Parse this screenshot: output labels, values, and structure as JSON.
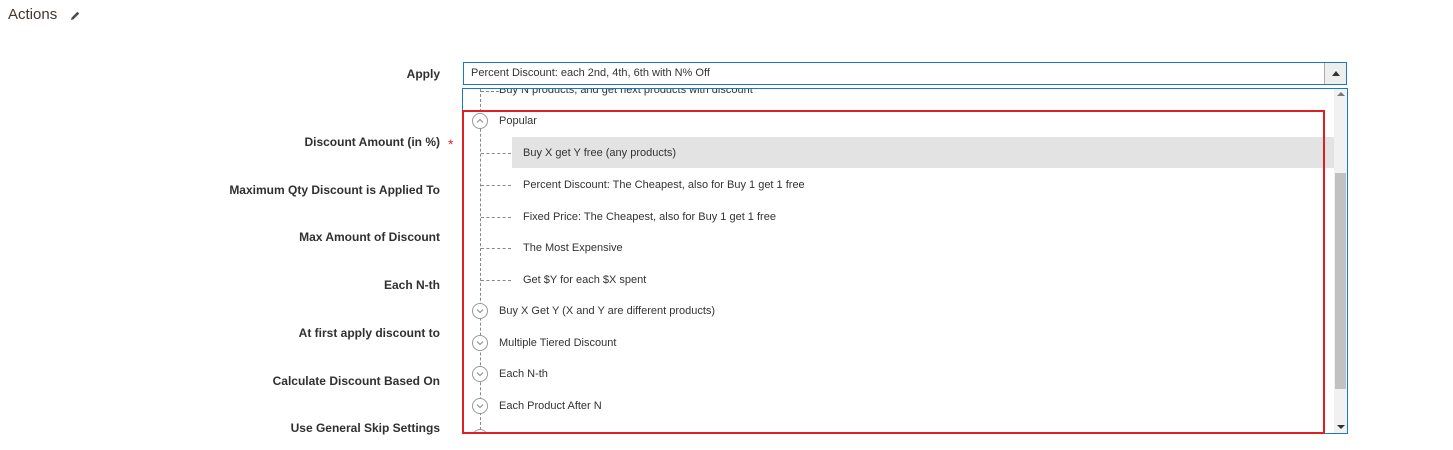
{
  "section": {
    "title": "Actions",
    "edit_icon": "pencil-icon"
  },
  "labels": {
    "apply": "Apply",
    "discount_amount": "Discount Amount (in %)",
    "required_mark": "*",
    "max_qty": "Maximum Qty Discount is Applied To",
    "max_amount": "Max Amount of Discount",
    "each_nth": "Each N-th",
    "first_apply": "At first apply discount to",
    "calculate_based": "Calculate Discount Based On",
    "skip_settings": "Use General Skip Settings"
  },
  "apply_select": {
    "selected": "Percent Discount: each 2nd, 4th, 6th with N% Off"
  },
  "dropdown": {
    "partial_top": "Buy N products, and get next products with discount",
    "groups": [
      {
        "label": "Popular",
        "expanded": true,
        "items": [
          "Buy X get Y free (any products)",
          "Percent Discount: The Cheapest, also for Buy 1 get 1 free",
          "Fixed Price: The Cheapest, also for Buy 1 get 1 free",
          "The Most Expensive",
          "Get $Y for each $X spent"
        ]
      },
      {
        "label": "Buy X Get Y (X and Y are different products)",
        "expanded": false
      },
      {
        "label": "Multiple Tiered Discount",
        "expanded": false
      },
      {
        "label": "Each N-th",
        "expanded": false
      },
      {
        "label": "Each Product After N",
        "expanded": false
      }
    ],
    "hovered_item": "Buy X get Y free (any products)"
  },
  "colors": {
    "focus_border": "#1979c3",
    "highlight_border": "#e02020",
    "required": "#e22626",
    "hover_bg": "#e3e3e3"
  }
}
